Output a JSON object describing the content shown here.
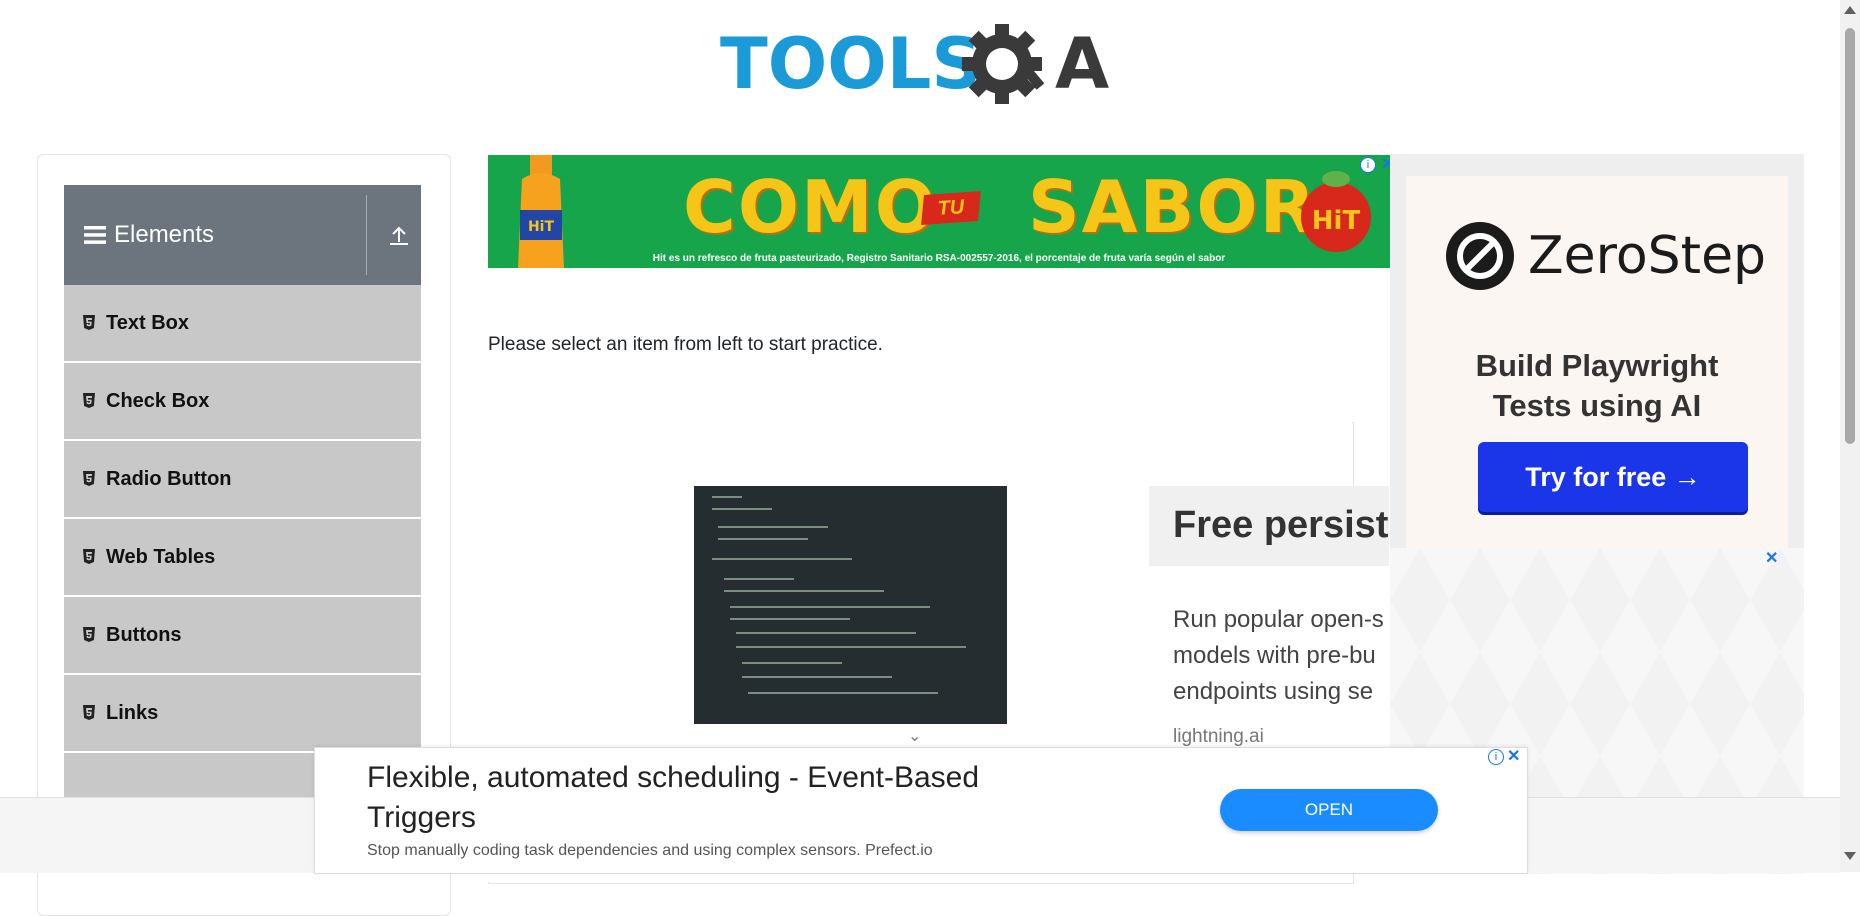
{
  "header": {
    "logo_text_part1": "TOOLS",
    "logo_text_part2": "A"
  },
  "sidebar": {
    "group_title": "Elements",
    "items": [
      {
        "label": "Text Box"
      },
      {
        "label": "Check Box"
      },
      {
        "label": "Radio Button"
      },
      {
        "label": "Web Tables"
      },
      {
        "label": "Buttons"
      },
      {
        "label": "Links"
      }
    ]
  },
  "main": {
    "intro_text": "Please select an item from left to start practice."
  },
  "ad_top": {
    "headline_left": "COMO",
    "headline_mid": "TU",
    "headline_right": "SABOR",
    "brand": "HiT",
    "legal": "Hit es un refresco de fruta pasteurizado, Registro Sanitario RSA-002557-2016, el porcentaje de fruta varía según el sabor"
  },
  "ad_mid": {
    "title": "Free persiste",
    "description": "Run popular open-s\nmodels with pre-bu\nendpoints using se",
    "domain": "lightning.ai"
  },
  "ad_right": {
    "brand": "ZeroStep",
    "tagline": "Build Playwright Tests using AI",
    "cta": "Try for free →"
  },
  "ad_bottom": {
    "headline": "Flexible, automated scheduling - Event-Based Triggers",
    "subtext": "Stop manually coding task dependencies and using complex sensors. Prefect.io",
    "cta": "OPEN"
  },
  "colors": {
    "logo_blue": "#1a9ad6",
    "logo_dark": "#3a3a3a",
    "sidebar_header": "#6c757d",
    "menu_item_bg": "#c8c8c8",
    "ad_green": "#17a54b",
    "zerostep_button": "#1a36e8",
    "open_button": "#1a8cff"
  }
}
